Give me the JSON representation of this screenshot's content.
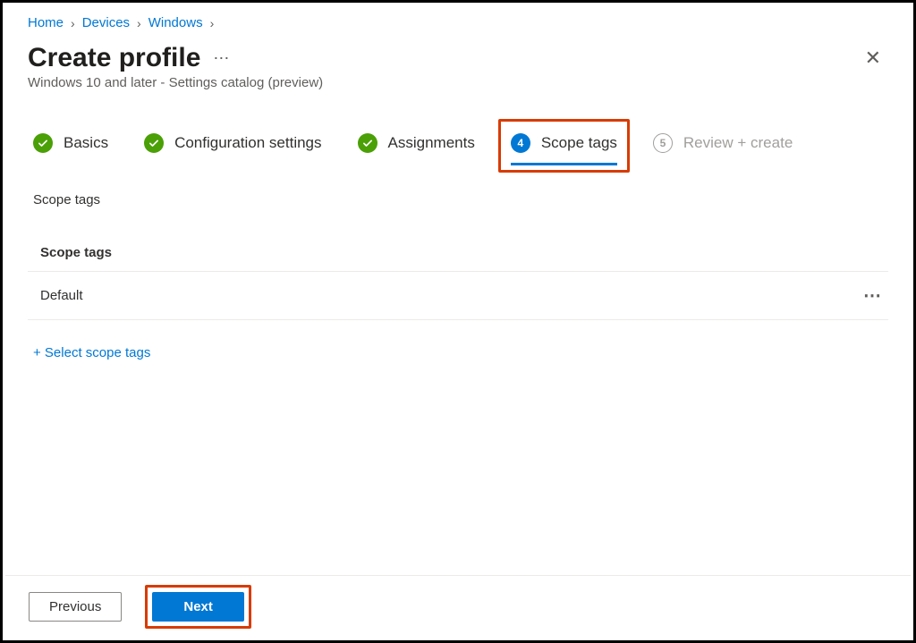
{
  "breadcrumbs": {
    "items": [
      "Home",
      "Devices",
      "Windows"
    ]
  },
  "header": {
    "title": "Create profile",
    "subtitle": "Windows 10 and later - Settings catalog (preview)"
  },
  "steps": {
    "items": [
      {
        "label": "Basics",
        "state": "done"
      },
      {
        "label": "Configuration settings",
        "state": "done"
      },
      {
        "label": "Assignments",
        "state": "done"
      },
      {
        "num": "4",
        "label": "Scope tags",
        "state": "current"
      },
      {
        "num": "5",
        "label": "Review + create",
        "state": "pending"
      }
    ]
  },
  "section": {
    "label": "Scope tags",
    "tableHeader": "Scope tags",
    "rows": [
      {
        "value": "Default"
      }
    ],
    "addLink": "+ Select scope tags"
  },
  "footer": {
    "previous": "Previous",
    "next": "Next"
  }
}
